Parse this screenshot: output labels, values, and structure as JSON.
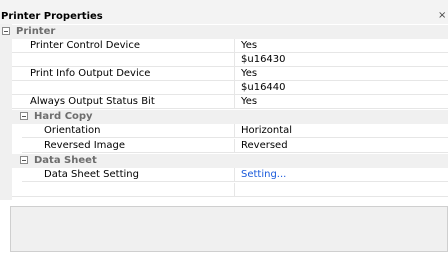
{
  "window": {
    "title": "Printer Properties",
    "close_icon": "×"
  },
  "categories": {
    "printer": "Printer",
    "hard_copy": "Hard Copy",
    "data_sheet": "Data Sheet"
  },
  "properties": {
    "printer_control_device": {
      "label": "Printer Control Device",
      "value": "Yes",
      "sub_value": "$u16430"
    },
    "print_info_output_device": {
      "label": "Print Info Output Device",
      "value": "Yes",
      "sub_value": "$u16440"
    },
    "always_output_status_bit": {
      "label": "Always Output Status Bit",
      "value": "Yes"
    },
    "orientation": {
      "label": "Orientation",
      "value": "Horizontal"
    },
    "reversed_image": {
      "label": "Reversed Image",
      "value": "Reversed"
    },
    "data_sheet_setting": {
      "label": "Data Sheet Setting",
      "value": "Setting..."
    }
  }
}
